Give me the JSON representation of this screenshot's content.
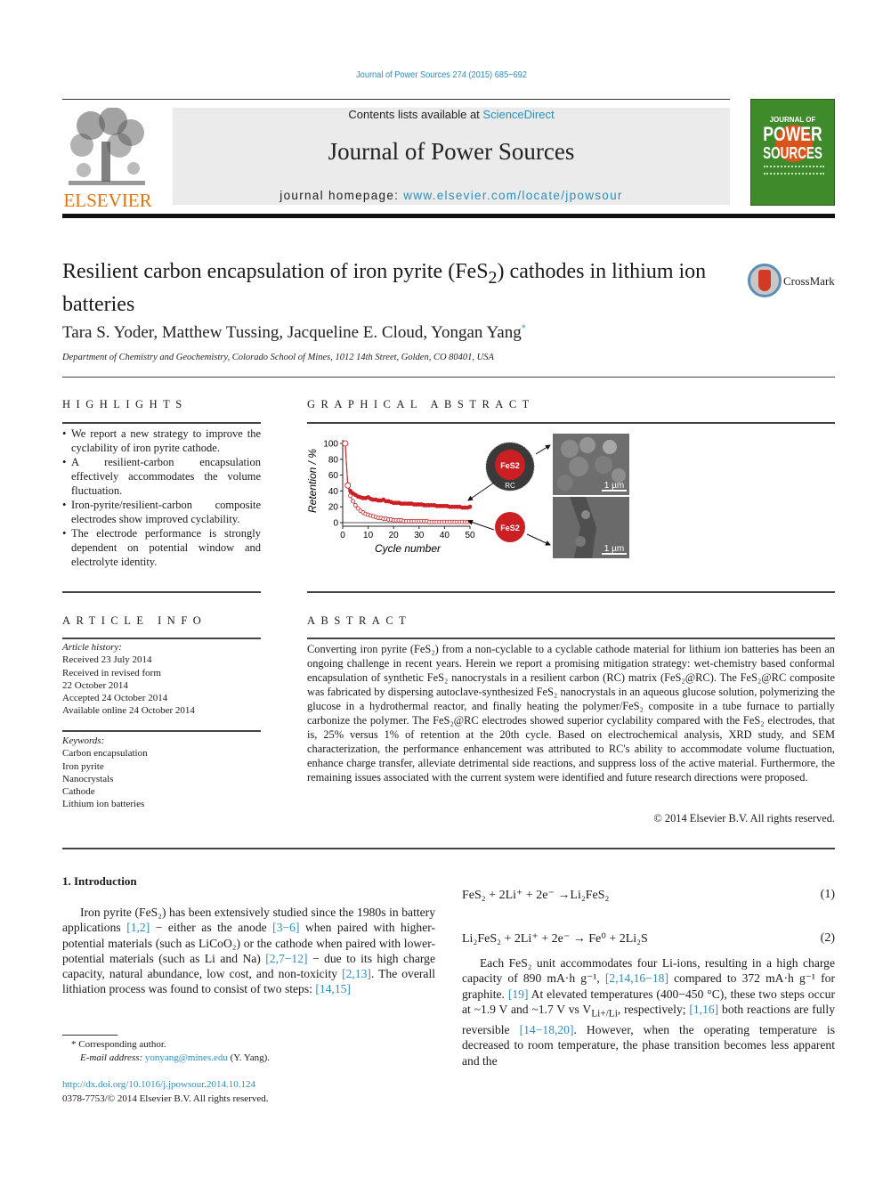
{
  "header": {
    "journal_ref": "Journal of Power Sources 274 (2015) 685−692",
    "contents_prefix": "Contents lists available at ",
    "contents_link": "ScienceDirect",
    "journal_title": "Journal of Power Sources",
    "homepage_prefix": "journal homepage: ",
    "homepage_link": "www.elsevier.com/locate/jpowsour",
    "publisher_logo": "ELSEVIER",
    "cover": {
      "line1": "JOURNAL OF",
      "line2": "POWER",
      "line3": "SOURCES",
      "bg_color": "#3f8a2a"
    }
  },
  "article": {
    "title_part1": "Resilient carbon encapsulation of iron pyrite (FeS",
    "title_sub": "2",
    "title_part2": ") cathodes in lithium ion batteries",
    "crossmark_label": "CrossMark",
    "authors": "Tara S. Yoder, Matthew Tussing, Jacqueline E. Cloud, Yongan Yang",
    "author_mark": "*",
    "affiliation": "Department of Chemistry and Geochemistry, Colorado School of Mines, 1012 14th Street, Golden, CO 80401, USA"
  },
  "highlights": {
    "heading": "HIGHLIGHTS",
    "items": [
      "We report a new strategy to improve the cyclability of iron pyrite cathode.",
      "A resilient-carbon encapsulation effectively accommodates the volume fluctuation.",
      "Iron-pyrite/resilient-carbon composite electrodes show improved cyclability.",
      "The electrode performance is strongly dependent on potential window and electrolyte identity."
    ]
  },
  "graphical_abstract": {
    "heading": "GRAPHICAL ABSTRACT",
    "core_label": "FeS2",
    "shell_label": "RC",
    "bare_label": "FeS2",
    "scale_bar_label": "1 µm"
  },
  "chart_data": {
    "type": "line",
    "title": "",
    "xlabel": "Cycle number",
    "ylabel": "Retention / %",
    "xlim": [
      0,
      50
    ],
    "ylim": [
      0,
      100
    ],
    "xticks": [
      0,
      10,
      20,
      30,
      40,
      50
    ],
    "yticks": [
      0,
      20,
      40,
      60,
      80,
      100
    ],
    "x": [
      1,
      2,
      3,
      4,
      5,
      6,
      7,
      8,
      9,
      10,
      11,
      12,
      13,
      14,
      15,
      16,
      17,
      18,
      19,
      20,
      21,
      22,
      23,
      24,
      25,
      26,
      27,
      28,
      29,
      30,
      31,
      32,
      33,
      34,
      35,
      36,
      37,
      38,
      39,
      40,
      41,
      42,
      43,
      44,
      45,
      46,
      47,
      48,
      49,
      50
    ],
    "series": [
      {
        "name": "FeS2@RC",
        "marker": "filled-circle",
        "color": "#cc1f24",
        "values": [
          100,
          47,
          40,
          37,
          35,
          33,
          32,
          31,
          31,
          32,
          30,
          29,
          29,
          28,
          28,
          29,
          27,
          27,
          26,
          25,
          25,
          25,
          24,
          24,
          24,
          24,
          24,
          23,
          23,
          23,
          23,
          22,
          22,
          22,
          22,
          22,
          21,
          21,
          21,
          21,
          21,
          20,
          20,
          20,
          20,
          20,
          19,
          19,
          19,
          20
        ]
      },
      {
        "name": "FeS2",
        "marker": "open-circle",
        "color": "#cc1f24",
        "values": [
          100,
          47,
          34,
          27,
          22,
          18,
          15,
          13,
          11,
          10,
          9,
          8,
          7,
          6,
          6,
          5,
          5,
          4,
          4,
          3,
          3,
          3,
          3,
          2,
          2,
          2,
          2,
          2,
          2,
          2,
          2,
          2,
          2,
          1,
          1,
          1,
          1,
          1,
          1,
          1,
          1,
          1,
          1,
          1,
          1,
          1,
          1,
          1,
          1,
          1
        ]
      }
    ],
    "legend": "none"
  },
  "article_info": {
    "heading": "ARTICLE INFO",
    "history_label": "Article history:",
    "history": [
      "Received 23 July 2014",
      "Received in revised form",
      "22 October 2014",
      "Accepted 24 October 2014",
      "Available online 24 October 2014"
    ],
    "keywords_label": "Keywords:",
    "keywords": [
      "Carbon encapsulation",
      "Iron pyrite",
      "Nanocrystals",
      "Cathode",
      "Lithium ion batteries"
    ]
  },
  "abstract": {
    "heading": "ABSTRACT",
    "text": "Converting iron pyrite (FeS₂) from a non-cyclable to a cyclable cathode material for lithium ion batteries has been an ongoing challenge in recent years. Herein we report a promising mitigation strategy: wet-chemistry based conformal encapsulation of synthetic FeS₂ nanocrystals in a resilient carbon (RC) matrix (FeS₂@RC). The FeS₂@RC composite was fabricated by dispersing autoclave-synthesized FeS₂ nanocrystals in an aqueous glucose solution, polymerizing the glucose in a hydrothermal reactor, and finally heating the polymer/FeS₂ composite in a tube furnace to partially carbonize the polymer. The FeS₂@RC electrodes showed superior cyclability compared with the FeS₂ electrodes, that is, 25% versus 1% of retention at the 20th cycle. Based on electrochemical analysis, XRD study, and SEM characterization, the performance enhancement was attributed to RC's ability to accommodate volume fluctuation, enhance charge transfer, alleviate detrimental side reactions, and suppress loss of the active material. Furthermore, the remaining issues associated with the current system were identified and future research directions were proposed.",
    "copyright": "© 2014 Elsevier B.V. All rights reserved."
  },
  "introduction": {
    "heading": "1.  Introduction",
    "p1_a": "Iron pyrite (FeS₂) has been extensively studied since the 1980s in battery applications ",
    "ref1": "[1,2]",
    "p1_b": " − either as the anode ",
    "ref2": "[3−6]",
    "p1_c": " when paired with higher-potential materials (such as LiCoO₂) or the cathode when paired with lower-potential materials (such as Li and Na) ",
    "ref3": "[2,7−12]",
    "p1_d": " − due to its high charge capacity, natural abundance, low cost, and non-toxicity ",
    "ref4": "[2,13]",
    "p1_e": ". The overall lithiation process was found to consist of two steps: ",
    "ref5": "[14,15]",
    "eq1": "FeS₂ + 2Li⁺ + 2e⁻ →Li₂FeS₂",
    "eq1_num": "(1)",
    "eq2": "Li₂FeS₂ + 2Li⁺ + 2e⁻ → Fe⁰ + 2Li₂S",
    "eq2_num": "(2)",
    "p2_a": "Each FeS₂ unit accommodates four Li-ions, resulting in a high charge capacity of 890 mA·h g⁻¹, ",
    "ref6": "[2,14,16−18]",
    "p2_b": " compared to 372 mA·h g⁻¹ for graphite. ",
    "ref7": "[19]",
    "p2_c": " At elevated temperatures (400−450 °C), these two steps occur at ~1.9 V and ~1.7 V vs V",
    "p2_sub": "Li+/Li",
    "p2_d": ", respectively; ",
    "ref8": "[1,16]",
    "p2_e": " both reactions are fully reversible ",
    "ref9": "[14−18,20]",
    "p2_f": ". However, when the operating temperature is decreased to room temperature, the phase transition becomes less apparent and the"
  },
  "footnotes": {
    "corresponding": "* Corresponding author.",
    "email_label": "E-mail address: ",
    "email": "yonyang@mines.edu",
    "email_suffix": " (Y. Yang).",
    "doi": "http://dx.doi.org/10.1016/j.jpowsour.2014.10.124",
    "issn_line": "0378-7753/© 2014 Elsevier B.V. All rights reserved."
  }
}
